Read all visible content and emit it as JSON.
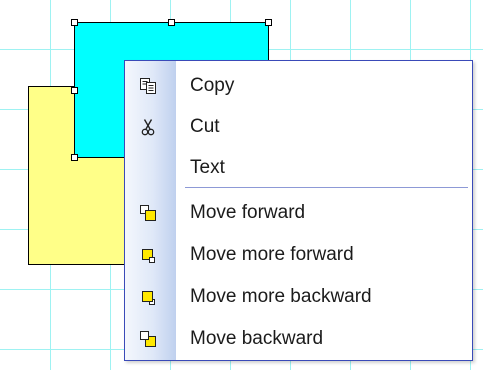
{
  "colors": {
    "canvas_background": "#ffffff",
    "grid_line": "#9ef2f2",
    "shape_yellow": "#ffff88",
    "shape_cyan": "#00ffff",
    "menu_border": "#3a4ab8",
    "icon_yellow": "#ffe800"
  },
  "canvas": {
    "shapes": [
      {
        "name": "yellow-rectangle",
        "fill": "#ffff88",
        "selected": false
      },
      {
        "name": "cyan-rectangle",
        "fill": "#00ffff",
        "selected": true
      }
    ]
  },
  "context_menu": {
    "items": [
      {
        "label": "Copy",
        "icon": "copy-icon"
      },
      {
        "label": "Cut",
        "icon": "scissors-icon"
      },
      {
        "label": "Text",
        "icon": ""
      },
      {
        "label": "Move forward",
        "icon": "move-forward-icon"
      },
      {
        "label": "Move more forward",
        "icon": "move-more-forward-icon"
      },
      {
        "label": "Move more backward",
        "icon": "move-more-backward-icon"
      },
      {
        "label": "Move backward",
        "icon": "move-backward-icon"
      }
    ]
  }
}
